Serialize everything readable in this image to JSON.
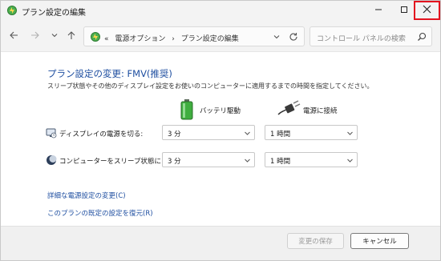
{
  "window": {
    "title": "プラン設定の編集",
    "accent_color": "#1e4ea0",
    "close_highlight_color": "#e3141f"
  },
  "nav": {
    "address_prefix": "«",
    "crumbs": [
      "電源オプション",
      "プラン設定の編集"
    ],
    "search_placeholder": "コントロール パネルの検索"
  },
  "main": {
    "heading": "プラン設定の変更: FMV(推奨)",
    "description": "スリープ状態やその他のディスプレイ設定をお使いのコンピューターに適用するまでの時間を指定してください。",
    "columns": {
      "battery": "バッテリ駆動",
      "plugged": "電源に接続"
    },
    "settings": [
      {
        "label": "ディスプレイの電源を切る:",
        "battery": "3 分",
        "plugged": "1 時間"
      },
      {
        "label": "コンピューターをスリープ状態にする:",
        "battery": "3 分",
        "plugged": "1 時間"
      }
    ],
    "links": {
      "advanced": "詳細な電源設定の変更(C)",
      "restore": "このプランの既定の設定を復元(R)"
    }
  },
  "footer": {
    "save_label": "変更の保存",
    "cancel_label": "キャンセル"
  }
}
